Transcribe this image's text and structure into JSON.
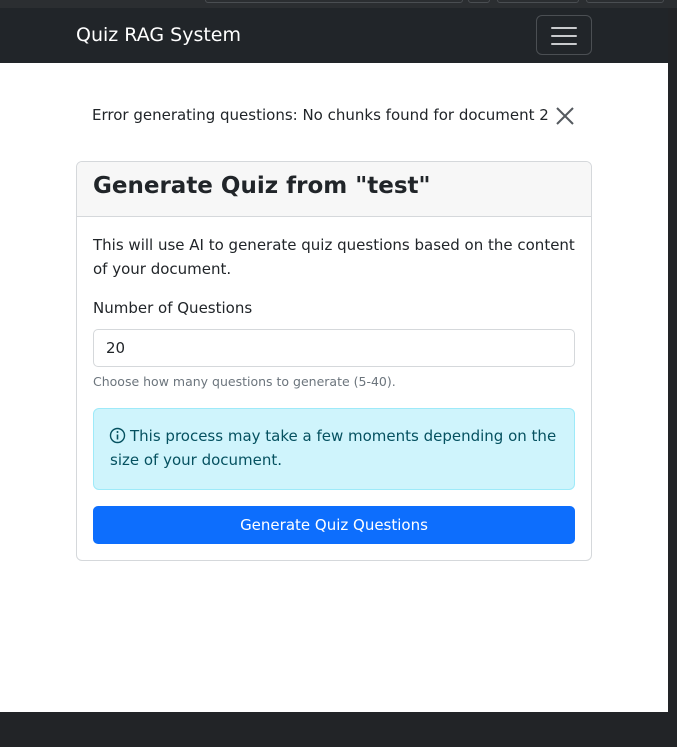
{
  "navbar": {
    "brand": "Quiz RAG System",
    "toggler_icon": "hamburger-menu-icon"
  },
  "alert": {
    "message": "Error generating questions: No chunks found for document 2",
    "close_icon": "close-icon"
  },
  "card": {
    "title": "Generate Quiz from \"test\"",
    "intro": "This will use AI to generate quiz questions based on the content of your document.",
    "num_questions_label": "Number of Questions",
    "num_questions_value": "20",
    "help_text": "Choose how many questions to generate (5-40).",
    "info_icon": "info-circle-icon",
    "info_text": "This process may take a few moments depending on the size of your document.",
    "submit_label": "Generate Quiz Questions"
  },
  "colors": {
    "navbar_bg": "#212529",
    "primary": "#0d6efd",
    "info_bg": "#cff4fc",
    "info_text": "#055160"
  }
}
